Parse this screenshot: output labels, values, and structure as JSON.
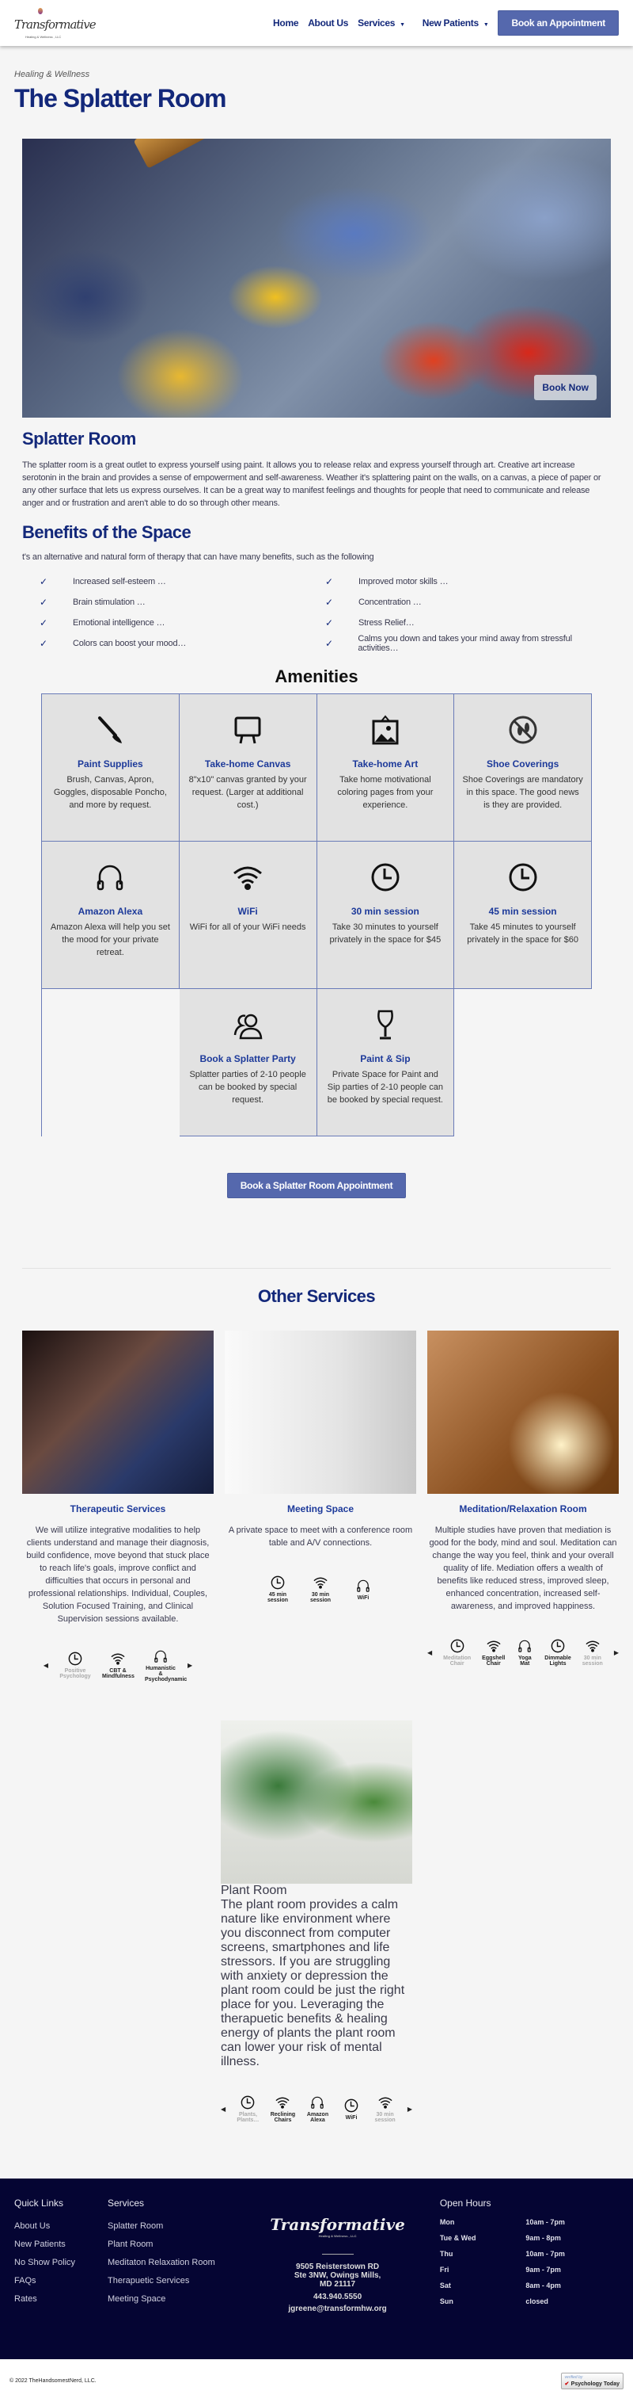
{
  "header": {
    "logo_text": "Transformative",
    "logo_sub": "Healing & Wellness , LLC",
    "nav": [
      {
        "label": "Home"
      },
      {
        "label": "About Us"
      },
      {
        "label": "Services",
        "dropdown": true
      },
      {
        "label": "New Patients",
        "dropdown": true
      }
    ],
    "cta": "Book an Appointment"
  },
  "hero": {
    "eyebrow": "Healing & Wellness",
    "title": "The Splatter Room",
    "book_now": "Book Now"
  },
  "about": {
    "title": "Splatter Room",
    "text": "The splatter room is a great outlet to express yourself using paint. It allows you to release relax and express yourself through art. Creative art increase serotonin in the brain and provides a sense of empowerment and self-awareness. Weather it's splattering paint on the walls, on a canvas, a piece of paper or any other surface that lets us express ourselves. It can be a great way to manifest feelings and thoughts for people that need to communicate and release anger and or frustration and aren't able to do so through other means."
  },
  "benefits": {
    "title": "Benefits of the Space",
    "intro": "t's an alternative and natural form of therapy that can have many benefits, such as the following",
    "items": [
      "Increased self-esteem …",
      "Improved motor skills …",
      "Brain stimulation …",
      "Concentration …",
      "Emotional intelligence …",
      "Stress Relief…",
      "Colors can boost your mood…",
      "Calms you down and takes your mind away from stressful activities…"
    ]
  },
  "amenities": {
    "title": "Amenities",
    "items": [
      {
        "icon": "paintbrush-icon",
        "title": "Paint Supplies",
        "desc": "Brush, Canvas, Apron, Goggles, disposable Poncho, and more by request."
      },
      {
        "icon": "easel-icon",
        "title": "Take-home Canvas",
        "desc": "8\"x10\" canvas granted by your request. (Larger at additional cost.)"
      },
      {
        "icon": "framed-picture-icon",
        "title": "Take-home Art",
        "desc": "Take home motivational coloring pages from your experience."
      },
      {
        "icon": "no-shoes-icon",
        "title": "Shoe Coverings",
        "desc": "Shoe Coverings are mandatory in this space. The good news is they are provided."
      },
      {
        "icon": "headphones-icon",
        "title": "Amazon Alexa",
        "desc": "Amazon Alexa will help you set the mood for your private retreat."
      },
      {
        "icon": "wifi-icon",
        "title": "WiFi",
        "desc": "WiFi for all of your WiFi needs"
      },
      {
        "icon": "clock-icon",
        "title": "30 min session",
        "desc": "Take 30 minutes to yourself privately in the space for $45"
      },
      {
        "icon": "clock-icon",
        "title": "45 min session",
        "desc": "Take 45 minutes to yourself privately in the space for $60"
      },
      {
        "icon": "people-icon",
        "title": "Book a Splatter Party",
        "desc": "Splatter parties of 2-10 people can be booked by special request."
      },
      {
        "icon": "wine-glass-icon",
        "title": "Paint & Sip",
        "desc": "Private Space for Paint and Sip parties of 2-10 people can be booked by special request."
      }
    ]
  },
  "cta": "Book a Splatter Room Appointment",
  "other": {
    "title": "Other Services",
    "services": [
      {
        "title": "Therapeutic Services",
        "desc": "We will utilize integrative modalities to help clients understand and manage their diagnosis, build confidence, move beyond that stuck place to reach life's goals, improve conflict and difficulties that occurs in personal and professional relationships. Individual, Couples, Solution Focused Training, and Clinical Supervision sessions available.",
        "features": [
          "Positive Psychology",
          "CBT & Mindfulness",
          "Humanistic & Psychodynamic"
        ]
      },
      {
        "title": "Meeting Space",
        "desc": "A private space to meet with a conference room table and A/V connections.",
        "features": [
          "45 min session",
          "30 min session",
          "WiFi"
        ]
      },
      {
        "title": "Meditation/Relaxation Room",
        "desc": "Multiple studies have proven that mediation is good for the body, mind and soul. Meditation can change the way you feel, think and your overall quality of life. Mediation offers a wealth of benefits like reduced stress, improved sleep, enhanced concentration, increased self-awareness, and improved happiness.",
        "features": [
          "Meditation Chair",
          "Eggshell Chair",
          "Yoga Mat",
          "Dimmable Lights",
          "30 min session"
        ]
      },
      {
        "title": "Plant Room",
        "desc": "The plant room provides a calm nature like environment where you disconnect from computer screens, smartphones and life stressors. If you are struggling with anxiety or depression the plant room could be just the right place for you. Leveraging the therapuetic benefits & healing energy of plants the plant room can lower your risk of mental illness.",
        "features": [
          "Plants, Plants…",
          "Reclining Chairs",
          "Amazon Alexa",
          "WiFi",
          "30 min session"
        ]
      }
    ]
  },
  "footer": {
    "quick_title": "Quick Links",
    "quick": [
      "About Us",
      "New Patients",
      "No Show Policy",
      "FAQs",
      "Rates"
    ],
    "services_title": "Services",
    "services": [
      "Splatter Room",
      "Plant Room",
      "Meditaton Relaxation Room",
      "Therapuetic Services",
      "Meeting Space"
    ],
    "address1": "9505 Reisterstown RD",
    "address2": "Ste 3NW, Owings Mills,",
    "address3": "MD 21117",
    "phone": "443.940.5550",
    "email": "jgreene@transformhw.org",
    "hours_title": "Open Hours",
    "hours": [
      {
        "day": "Mon",
        "time": "10am - 7pm"
      },
      {
        "day": "Tue & Wed",
        "time": "9am - 8pm"
      },
      {
        "day": "Thu",
        "time": "10am - 7pm"
      },
      {
        "day": "Fri",
        "time": "9am - 7pm"
      },
      {
        "day": "Sat",
        "time": "8am - 4pm"
      },
      {
        "day": "Sun",
        "time": "closed"
      }
    ]
  },
  "bottom": {
    "copyright": "© 2022 TheHandsomestNerd, LLC.",
    "badge_top": "verified by",
    "badge": "Psychology Today"
  },
  "colors": {
    "brand": "#13287a",
    "button": "#5568ad",
    "footer": "#050533"
  }
}
